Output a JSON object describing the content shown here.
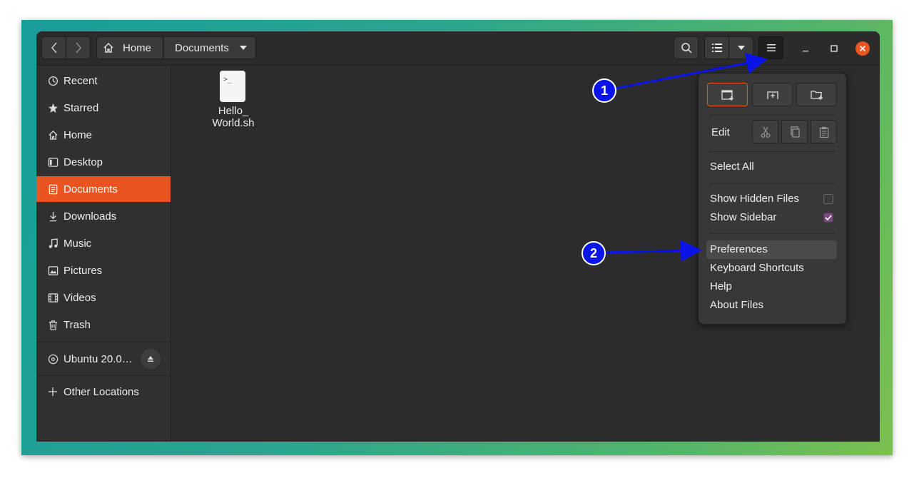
{
  "path_bar": {
    "home_label": "Home",
    "current_label": "Documents"
  },
  "sidebar": {
    "items": [
      {
        "label": "Recent",
        "icon": "clock-icon"
      },
      {
        "label": "Starred",
        "icon": "star-icon"
      },
      {
        "label": "Home",
        "icon": "home-icon"
      },
      {
        "label": "Desktop",
        "icon": "desktop-icon"
      },
      {
        "label": "Documents",
        "icon": "document-icon",
        "active": true
      },
      {
        "label": "Downloads",
        "icon": "download-icon"
      },
      {
        "label": "Music",
        "icon": "music-icon"
      },
      {
        "label": "Pictures",
        "icon": "pictures-icon"
      },
      {
        "label": "Videos",
        "icon": "video-icon"
      },
      {
        "label": "Trash",
        "icon": "trash-icon"
      }
    ],
    "drive_label": "Ubuntu 20.0…",
    "other_locations": "Other Locations"
  },
  "files": [
    {
      "name_line1": "Hello_",
      "name_line2": "World.sh",
      "icon_glyph": ">_"
    }
  ],
  "menu": {
    "edit_label": "Edit",
    "select_all": "Select All",
    "show_hidden": "Show Hidden Files",
    "show_hidden_checked": false,
    "show_sidebar": "Show Sidebar",
    "show_sidebar_checked": true,
    "preferences": "Preferences",
    "keyboard_shortcuts": "Keyboard Shortcuts",
    "help": "Help",
    "about": "About Files"
  },
  "annotations": {
    "badge1": "1",
    "badge2": "2"
  },
  "colors": {
    "accent": "#e95420",
    "badge": "#0a14e6",
    "checkbox": "#7a4a7e"
  }
}
